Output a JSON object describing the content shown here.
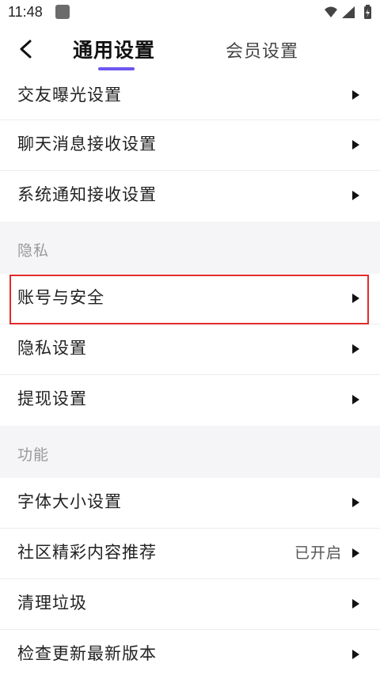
{
  "status_bar": {
    "time": "11:48"
  },
  "header": {
    "back_icon": "chevron-left-icon",
    "tabs": [
      {
        "label": "通用设置",
        "active": true
      },
      {
        "label": "会员设置",
        "active": false
      }
    ],
    "accent_color": "#6c57f0"
  },
  "list": {
    "group_top": [
      {
        "label": "交友曝光设置"
      },
      {
        "label": "聊天消息接收设置"
      },
      {
        "label": "系统通知接收设置"
      }
    ],
    "privacy": {
      "title": "隐私",
      "items": [
        {
          "label": "账号与安全",
          "highlighted": true
        },
        {
          "label": "隐私设置"
        },
        {
          "label": "提现设置"
        }
      ]
    },
    "features": {
      "title": "功能",
      "items": [
        {
          "label": "字体大小设置"
        },
        {
          "label": "社区精彩内容推荐",
          "value": "已开启"
        },
        {
          "label": "清理垃圾"
        },
        {
          "label": "检查更新最新版本"
        }
      ]
    }
  },
  "highlight_color": "#e22b2b"
}
